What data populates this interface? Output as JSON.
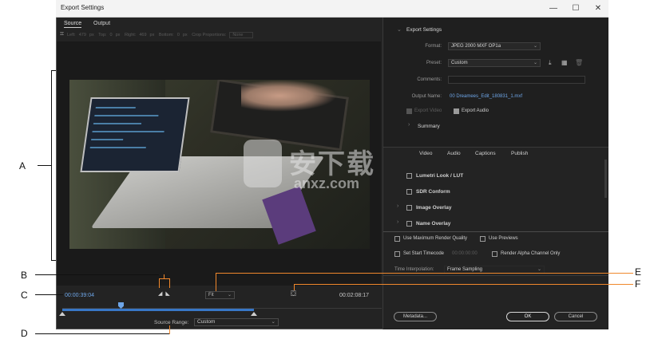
{
  "window": {
    "title": "Export Settings",
    "minimize": "—",
    "maximize": "☐",
    "close": "✕"
  },
  "preview_tabs": [
    "Source",
    "Output"
  ],
  "crop_toolbar": {
    "left_label": "Left:",
    "left_value": "479",
    "top_label": "Top:",
    "top_value": "0",
    "right_label": "Right:",
    "right_value": "469",
    "bottom_label": "Bottom:",
    "bottom_value": "0",
    "unit": "px",
    "crop_proportions_label": "Crop Proportions:",
    "crop_proportions_value": "None"
  },
  "timeline": {
    "current_timecode": "00:00:39:04",
    "duration_timecode": "00:02:08:17",
    "fit_value": "Fit",
    "source_range_label": "Source Range:",
    "source_range_value": "Custom",
    "playhead_position": 0.17,
    "in_point": 0.0,
    "out_point": 0.6
  },
  "export_settings": {
    "heading": "Export Settings",
    "format_label": "Format:",
    "format_value": "JPEG 2000 MXF OP1a",
    "preset_label": "Preset:",
    "preset_value": "Custom",
    "comments_label": "Comments:",
    "comments_value": "",
    "output_name_label": "Output Name:",
    "output_name_value": "00 Dreamees_Edit_180831_1.mxf",
    "export_video_label": "Export Video",
    "export_video_checked": true,
    "export_audio_label": "Export Audio",
    "export_audio_checked": true,
    "summary_label": "Summary"
  },
  "panel_tabs": [
    "Video",
    "Audio",
    "Captions",
    "Publish"
  ],
  "effects": [
    {
      "label": "Lumetri Look / LUT",
      "checked": false
    },
    {
      "label": "SDR Conform",
      "checked": false
    },
    {
      "label": "Image Overlay",
      "checked": false
    },
    {
      "label": "Name Overlay",
      "checked": false
    }
  ],
  "options": {
    "max_render_quality": "Use Maximum Render Quality",
    "use_previews": "Use Previews",
    "set_start_timecode": "Set Start Timecode",
    "start_timecode_value": "00:00:00:00",
    "render_alpha": "Render Alpha Channel Only",
    "time_interpolation_label": "Time Interpolation:",
    "time_interpolation_value": "Frame Sampling"
  },
  "buttons": {
    "metadata": "Metadata...",
    "ok": "OK",
    "cancel": "Cancel"
  },
  "annotations": {
    "A": "A",
    "B": "B",
    "C": "C",
    "D": "D",
    "E": "E",
    "F": "F"
  },
  "watermark": {
    "text": "安下载",
    "sub": "anxz.com"
  },
  "colors": {
    "accent_blue": "#6ea6e8",
    "callout_orange": "#f0882c",
    "panel_bg": "#232323"
  }
}
